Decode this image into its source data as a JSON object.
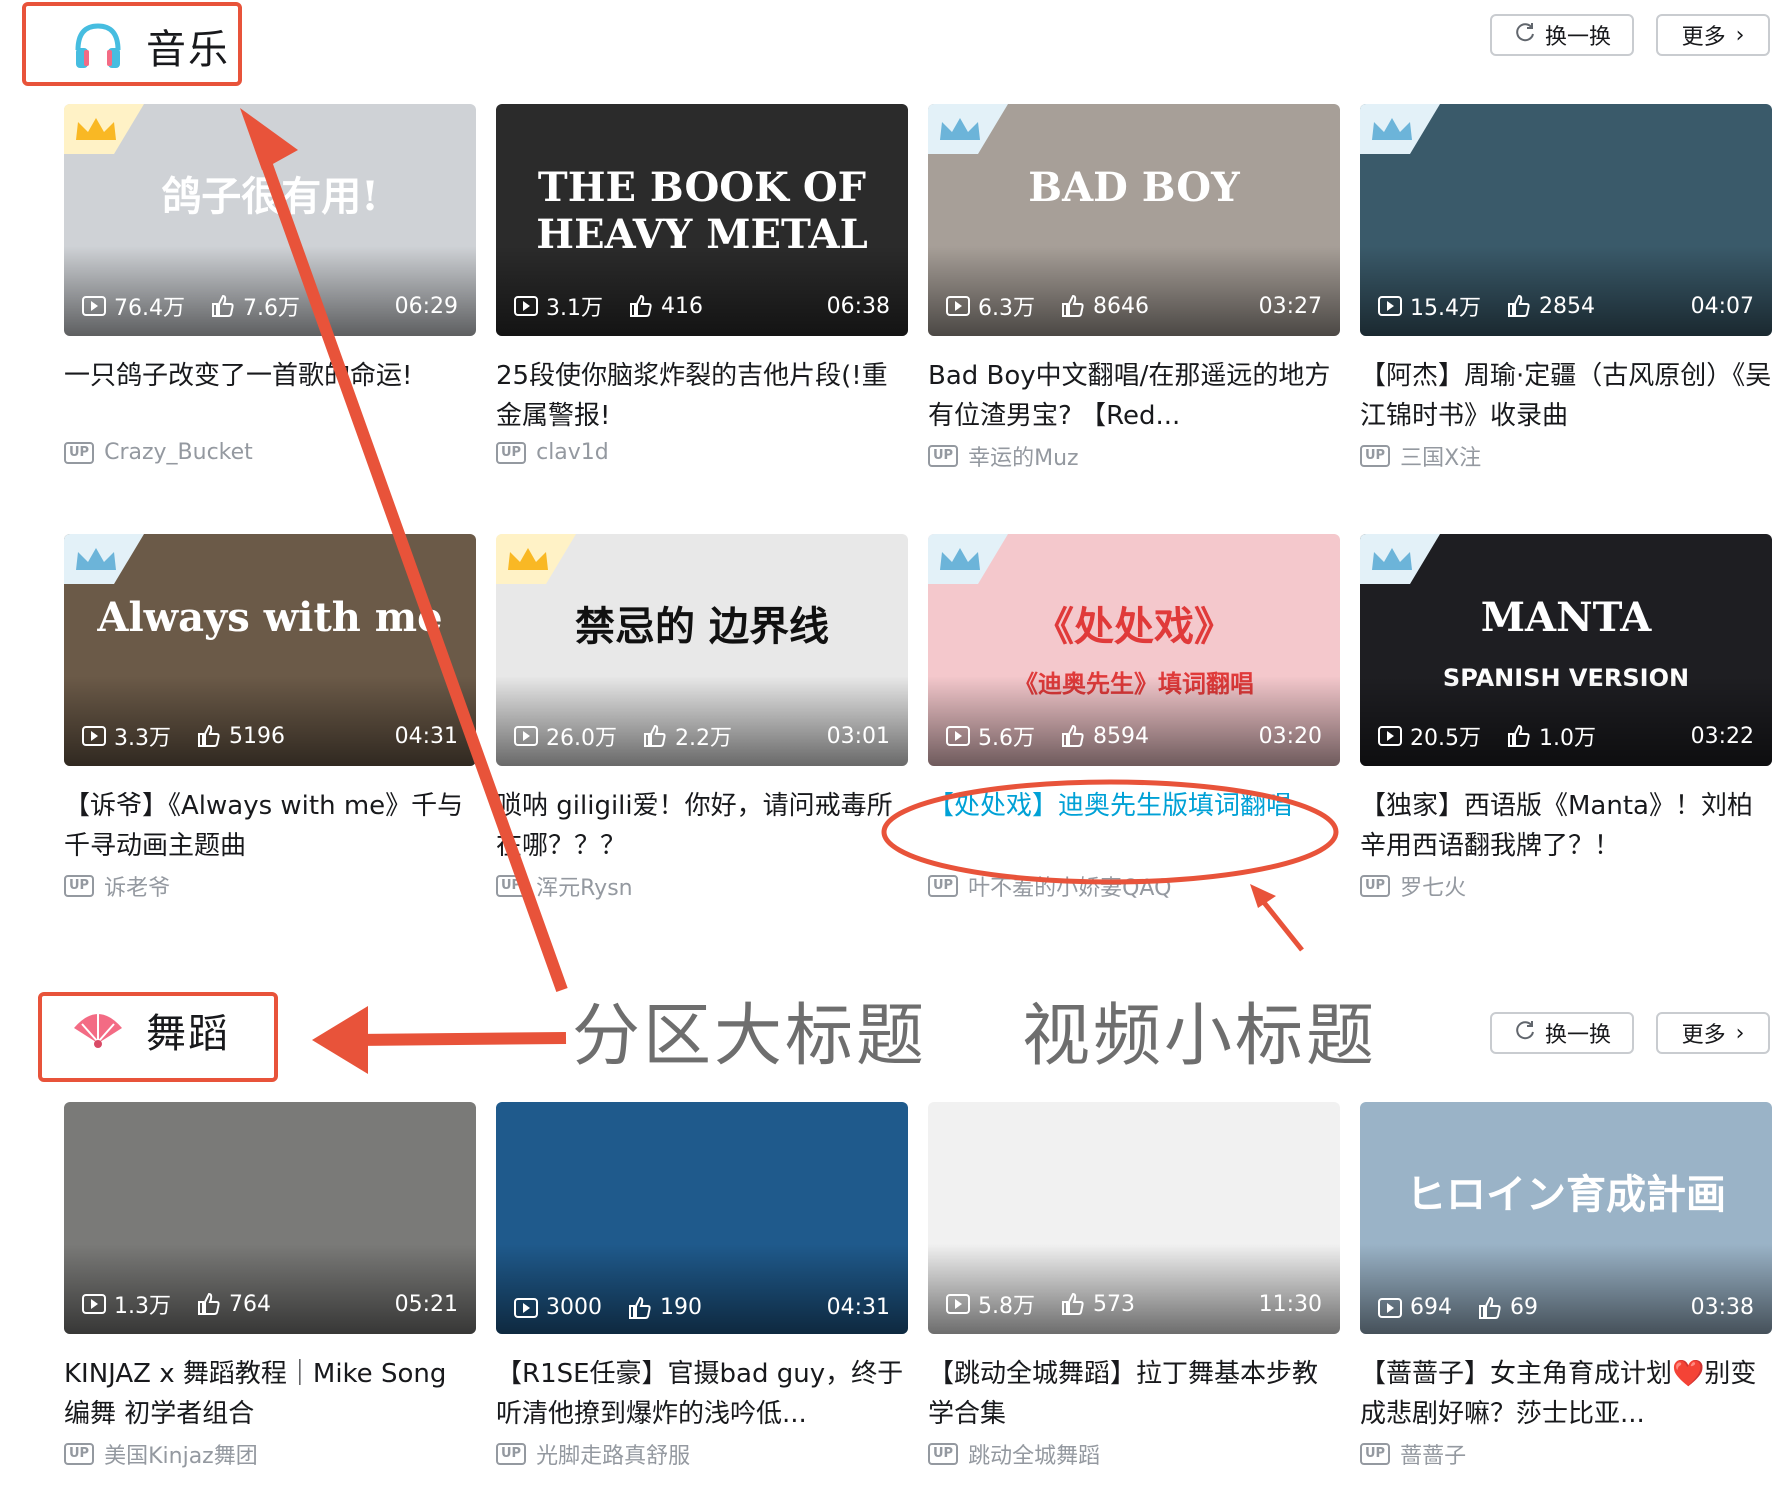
{
  "music": {
    "title": "音乐",
    "refresh_label": "换一换",
    "more_label": "更多",
    "videos": [
      {
        "views": "76.4万",
        "likes": "7.6万",
        "duration": "06:29",
        "title": "一只鸽子改变了一首歌的命运!",
        "up": "Crazy_Bucket",
        "thumb_text": "鸽子很有用!",
        "bg": "#cfd2d6",
        "crown": "gold"
      },
      {
        "views": "3.1万",
        "likes": "416",
        "duration": "06:38",
        "title": "25段使你脑浆炸裂的吉他片段(!重金属警报!",
        "up": "clav1d",
        "thumb_text": "THE BOOK OF HEAVY METAL",
        "bg": "#2b2b2b",
        "crown": ""
      },
      {
        "views": "6.3万",
        "likes": "8646",
        "duration": "03:27",
        "title": "Bad Boy中文翻唱/在那遥远的地方有位渣男宝? 【Red...",
        "up": "幸运的Muz",
        "thumb_text": "BAD BOY",
        "bg": "#a79f98",
        "crown": "silver"
      },
      {
        "views": "15.4万",
        "likes": "2854",
        "duration": "04:07",
        "title": "【阿杰】周瑜·定疆（古风原创）《吴江锦时书》收录曲",
        "up": "三国X注",
        "thumb_text": "",
        "bg": "#3a5a6a",
        "crown": "silver"
      },
      {
        "views": "3.3万",
        "likes": "5196",
        "duration": "04:31",
        "title": "【诉爷】《Always with me》千与千寻动画主题曲",
        "up": "诉老爷",
        "thumb_text": "Always with me",
        "bg": "#6b5a48",
        "crown": "silver"
      },
      {
        "views": "26.0万",
        "likes": "2.2万",
        "duration": "03:01",
        "title": "唢呐 giligili爱！你好，请问戒毒所在哪？？？",
        "up": "浑元Rysn",
        "thumb_text": "禁忌的 边界线",
        "bg": "#e8e8e8",
        "crown": "gold"
      },
      {
        "views": "5.6万",
        "likes": "8594",
        "duration": "03:20",
        "title": "【处处戏】迪奥先生版填词翻唱",
        "up": "叶不羞的小娇妻QAQ",
        "thumb_text": "《处处戏》",
        "thumb_sub": "《迪奥先生》填词翻唱",
        "bg": "#f4c8cc",
        "crown": "silver"
      },
      {
        "views": "20.5万",
        "likes": "1.0万",
        "duration": "03:22",
        "title": "【独家】西语版《Manta》！刘柏辛用西语翻我牌了？！",
        "up": "罗七火",
        "thumb_text": "MANTA",
        "thumb_sub": "SPANISH VERSION",
        "bg": "#1e1e22",
        "crown": "silver"
      }
    ]
  },
  "dance": {
    "title": "舞蹈",
    "refresh_label": "换一换",
    "more_label": "更多",
    "videos": [
      {
        "views": "1.3万",
        "likes": "764",
        "duration": "05:21",
        "title": "KINJAZ x 舞蹈教程｜Mike Song 编舞 初学者组合",
        "up": "美国Kinjaz舞团",
        "thumb_text": "",
        "bg": "#7a7a78",
        "crown": ""
      },
      {
        "views": "3000",
        "likes": "190",
        "duration": "04:31",
        "title": "【R1SE任豪】官摄bad guy，终于听清他撩到爆炸的浅吟低...",
        "up": "光脚走路真舒服",
        "thumb_text": "",
        "bg": "#1f5a8c",
        "crown": ""
      },
      {
        "views": "5.8万",
        "likes": "573",
        "duration": "11:30",
        "title": "【跳动全城舞蹈】拉丁舞基本步教学合集",
        "up": "跳动全城舞蹈",
        "thumb_text": "",
        "bg": "#f1f1f1",
        "crown": ""
      },
      {
        "views": "694",
        "likes": "69",
        "duration": "03:38",
        "title": "【蔷蔷子】女主角育成计划❤️别变成悲剧好嘛？莎士比亚...",
        "up": "蔷蔷子",
        "thumb_text": "ヒロイン育成計画",
        "bg": "#9ab3c7",
        "crown": ""
      }
    ]
  },
  "annotations": {
    "section_title": "分区大标题",
    "video_title": "视频小标题"
  },
  "colors": {
    "annotation_red": "#e8533a",
    "highlight_blue": "#00a1d6",
    "text_gray": "#9499a0"
  }
}
